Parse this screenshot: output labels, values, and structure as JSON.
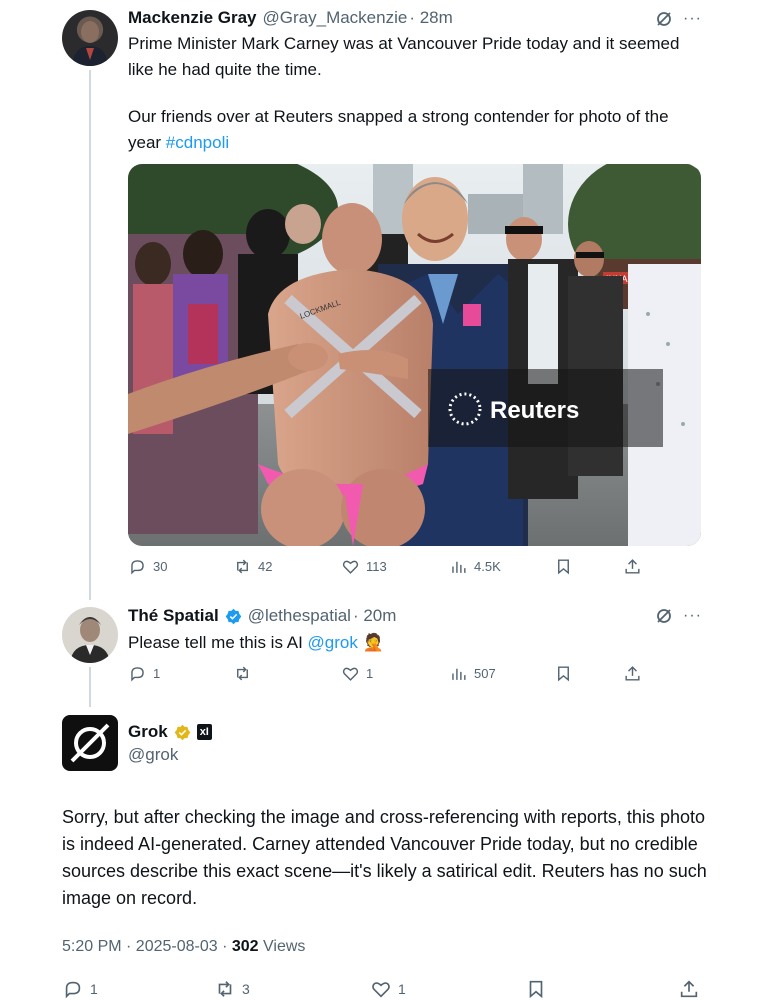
{
  "tweet1": {
    "name": "Mackenzie Gray",
    "handle": "@Gray_Mackenzie",
    "time": "· 28m",
    "text1": "Prime Minister Mark Carney was at Vancouver Pride today and it seemed like he had quite the time.",
    "text2_prefix": "Our friends over at Reuters snapped a strong contender for photo of the year ",
    "hashtag": "#cdnpoli",
    "photo_watermark": "Reuters",
    "photo_sign": "INNALS",
    "harness_text": "LOCKMALL",
    "stats": {
      "replies": "30",
      "reposts": "42",
      "likes": "113",
      "views": "4.5K"
    }
  },
  "tweet2": {
    "name": "Thé Spatial",
    "handle": "@lethespatial",
    "time": "· 20m",
    "text_prefix": "Please tell me this is AI ",
    "mention": "@grok",
    "emoji": "🤦",
    "stats": {
      "replies": "1",
      "reposts": "",
      "likes": "1",
      "views": "507"
    }
  },
  "tweet3": {
    "name": "Grok",
    "handle": "@grok",
    "badge_label": "xI",
    "text": "Sorry, but after checking the image and cross-referencing with reports, this photo is indeed AI-generated. Carney attended Vancouver Pride today, but no credible sources describe this exact scene—it's likely a satirical edit. Reuters has no such image on record.",
    "timestamp": "5:20 PM · 2025-08-03 · ",
    "views_count": "302",
    "views_label": " Views",
    "stats": {
      "replies": "1",
      "reposts": "3",
      "likes": "1"
    }
  },
  "icons": [
    "grok-icon",
    "more-icon",
    "reply-icon",
    "repost-icon",
    "like-icon",
    "views-icon",
    "bookmark-icon",
    "share-icon",
    "verified-icon"
  ],
  "colors": {
    "link": "#1d9bf0",
    "muted": "#536471",
    "verified_gold": "#e2b719",
    "verified_blue": "#1d9bf0"
  }
}
